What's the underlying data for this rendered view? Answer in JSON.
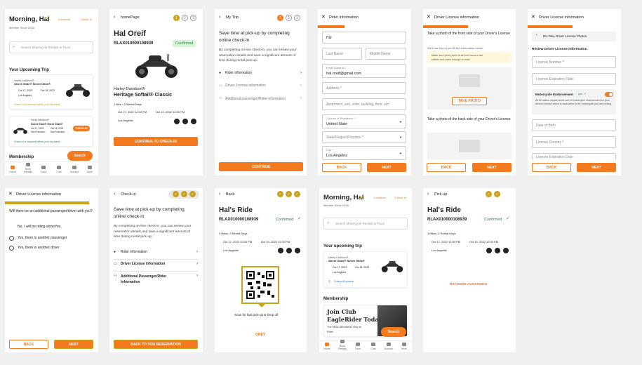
{
  "s1": {
    "greeting": "Morning, Hal",
    "member_since": "Member Since 2016",
    "locations": "Locations",
    "checkin": "Check-In",
    "search_placeholder": "Search Motorcycle Rentals & Tours",
    "upcoming_title": "Your Upcoming Trip",
    "trip1_brand": "Harley-Davidson®",
    "trip1_model": "Street Glide® Street Glide®",
    "trip1_from": "Oct 17, 2023",
    "trip1_to": "Oct 18, 2023",
    "trip1_loc": "Los Angeles",
    "trip1_note": "Check-in is required before your trip starts!",
    "trip2_brand": "Harley-Davidson®",
    "trip2_model": "Street Glide® Street Glide®",
    "trip2_from": "Oct 17, 2023",
    "trip2_to": "Oct 18, 2023",
    "trip2_loc1": "San Francisco",
    "trip2_loc2": "San Francisco",
    "trip2_checkin": "CHECK-IN",
    "trip2_note": "Check-in is required before your trip starts!",
    "membership": "Membership",
    "search_fab": "Search",
    "tabs": [
      "Home",
      "Book Rentals",
      "Tours",
      "Club",
      "Account",
      "More"
    ]
  },
  "s2": {
    "header": "homePage",
    "name": "Hal Oreif",
    "code": "RLAX010000108939",
    "status": "Confirmed",
    "bikes": "1 Bike • 2 Rental Days",
    "brand": "Harley-Davidson®",
    "model": "Heritage Softail® Classic",
    "from": "Oct 17, 2022  12:00 PM",
    "to": "Oct 19, 2022   12:00 PM",
    "loc": "Los Angeles",
    "cta": "CONTINUE TO CHECK-IN",
    "steps": [
      "1",
      "2",
      "3"
    ]
  },
  "s3": {
    "header": "My Trip",
    "title": "Save time at pick-up by completing online check-in",
    "body": "By completing on-line check-in, you can review your reservation details and save a significant amount of time during rental pick-up.",
    "items": [
      "Rider information",
      "Driver License information",
      "Additional passenger/Rider information"
    ],
    "cta": "CONTINUE",
    "steps": [
      "1",
      "2",
      "3"
    ]
  },
  "s4": {
    "header": "Rider information",
    "first": "Hal",
    "last": "Last Name",
    "middle": "Middle Name",
    "email_label": "Email Address *",
    "email": "hal.oreif@gmail.com",
    "address": "Address *",
    "apt": "Apartment, unit, suite, building, floor, etc.",
    "country_label": "Country of Residence *",
    "country": "United State",
    "state": "State/Region/Province *",
    "city_label": "City *",
    "city": "Los Angeles",
    "back": "BACK",
    "next": "NEXT"
  },
  "s5": {
    "header": "Driver License information",
    "front_title": "Take a photo of the front side of your Driver's License",
    "front_body": "We'll use this to pre-fill the information below.",
    "tip1": "Make sure your photo is all four corners are",
    "tip2": "visible and close enough to read.",
    "take_photo": "TAKE PHOTO",
    "back_title": "Take a photo of the back side of your Driver's License",
    "back": "BACK",
    "next": "NEXT"
  },
  "s6": {
    "header": "Driver License information",
    "retake": "Re-Take Driver License Photos",
    "review": "Review Driver License Information",
    "license_number": "License Number *",
    "license_exp": "License Expiration Date",
    "endorse": "Motorcycle Endorsement",
    "endorse_yes": "yes",
    "endorse_body": "All 50 states require some sort of motorcycle endorsement on your driver's license which is equivalent to the motorcycle you are renting.",
    "dob": "Date of Birth",
    "license_country": "License Country *",
    "license_exp2": "License Expiration Date",
    "back": "BACK",
    "next": "NEXT"
  },
  "s7": {
    "header": "Driver License information",
    "question": "Will there be an additional passenger/driver with you?",
    "opt1": "No, I will be riding aloneYes,",
    "opt2": "Yes, there is another passenger",
    "opt3": "Yes, there is another driver",
    "back": "BACK",
    "next": "NEXT"
  },
  "s8": {
    "header": "Check-in",
    "title": "Save time at pick-up by completing online check-in",
    "body": "By completing on-line check-in, you can review your reservation details and save a significant amount of time during rental pick-up.",
    "items": [
      "Rider information",
      "Driver License information",
      "Additional Passenger/Rider Information"
    ],
    "cta": "BACK TO YOU RESERVATION"
  },
  "s9": {
    "header": "Back",
    "title": "Hal's Ride",
    "code": "RLAX010000108939",
    "status": "Confirmed",
    "bikes": "3 Bikes, 2 Rental Days",
    "from": "Oct 17, 2022  12:00 PM",
    "to": "Oct 19, 2022  12:00 PM",
    "loc": "Los Angeles",
    "scan": "Scan for fast pick-up & Drop off",
    "okay": "OKEY"
  },
  "s10": {
    "greeting": "Morning, Hal",
    "member_since": "Member Since 2016",
    "locations": "Locations",
    "checkin": "Check-In",
    "search_placeholder": "Search Motorcycle Rentals & Tours",
    "upcoming_title": "Your upcoming trip",
    "brand": "Harley-Davidson®",
    "model": "Street Glide® Street Glide®",
    "from": "Oct 17, 2023",
    "to": "Oct 18, 2023",
    "loc": "Los Angeles",
    "days_left": "3 days till pickup",
    "membership": "Membership",
    "promo1": "Join Club",
    "promo2": "EagleRider Today",
    "promo3": "The Most Affordable Way to",
    "promo4": "Ride!",
    "search_fab": "Search",
    "tabs": [
      "Home",
      "Book Rentals",
      "Tours",
      "Club",
      "Account",
      "More"
    ]
  },
  "s11": {
    "header": "Pick-up",
    "title": "Hal's Ride",
    "code": "RLAX010000108939",
    "status": "Confirmed",
    "bikes": "3 Bikes, 2 Rental Days",
    "from": "Oct 17, 2022  12:00 PM",
    "to": "Oct 19, 2022  12:00 PM",
    "loc": "Los Angeles",
    "roadside": "ROADSIDE ASSISTANCE"
  }
}
